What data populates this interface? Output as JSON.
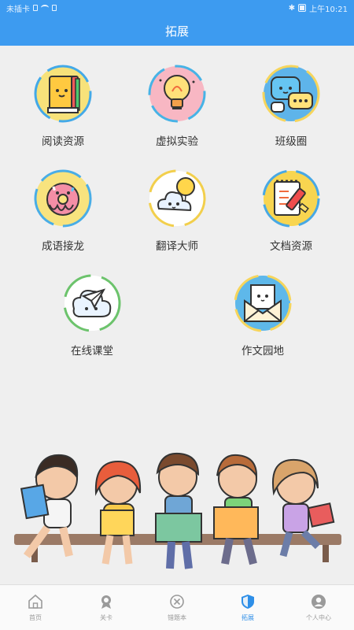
{
  "status_bar": {
    "carrier": "未插卡",
    "time": "上午10:21"
  },
  "header": {
    "title": "拓展"
  },
  "features": [
    {
      "label": "阅读资源",
      "icon": "book-icon"
    },
    {
      "label": "虚拟实验",
      "icon": "lightbulb-icon"
    },
    {
      "label": "班级圈",
      "icon": "chat-bubbles-icon"
    },
    {
      "label": "成语接龙",
      "icon": "donut-icon"
    },
    {
      "label": "翻译大师",
      "icon": "cloud-balloon-icon"
    },
    {
      "label": "文档资源",
      "icon": "notepad-marker-icon"
    },
    {
      "label": "在线课堂",
      "icon": "paper-plane-icon"
    },
    {
      "label": "作文园地",
      "icon": "envelope-letter-icon"
    }
  ],
  "tab_bar": {
    "tabs": [
      {
        "label": "首页",
        "icon": "home-icon",
        "active": false
      },
      {
        "label": "关卡",
        "icon": "badge-icon",
        "active": false
      },
      {
        "label": "错题本",
        "icon": "wrong-icon",
        "active": false
      },
      {
        "label": "拓展",
        "icon": "shield-icon",
        "active": true
      },
      {
        "label": "个人中心",
        "icon": "person-icon",
        "active": false
      }
    ]
  },
  "colors": {
    "primary": "#3d9bf0",
    "active_tab": "#2e8fe8",
    "inactive_tab": "#9a9a9a",
    "background": "#efefef"
  }
}
